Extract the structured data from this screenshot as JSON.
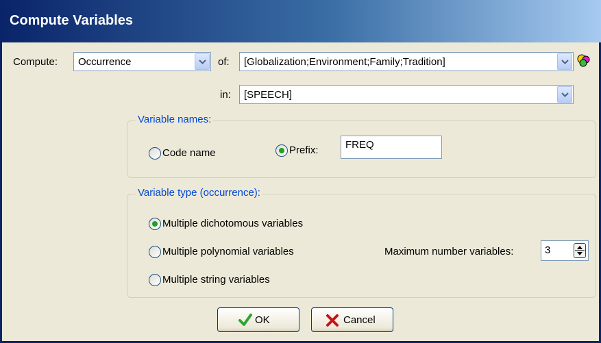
{
  "window": {
    "title": "Compute Variables"
  },
  "compute": {
    "label": "Compute:",
    "value": "Occurrence"
  },
  "of": {
    "label": "of:",
    "value": "[Globalization;Environment;Family;Tradition]",
    "icon": "variables-icon"
  },
  "in": {
    "label": "in:",
    "value": "[SPEECH]"
  },
  "variable_names": {
    "legend": "Variable names:",
    "code_name_label": "Code name",
    "prefix_label": "Prefix:",
    "prefix_value": "FREQ",
    "selected": "prefix"
  },
  "variable_type": {
    "legend": "Variable type (occurrence):",
    "options": [
      "Multiple dichotomous variables",
      "Multiple polynomial variables",
      "Multiple string variables"
    ],
    "selected_index": 0,
    "max_label": "Maximum number variables:",
    "max_value": "3"
  },
  "buttons": {
    "ok_label": "OK",
    "cancel_label": "Cancel"
  },
  "colors": {
    "titlebar": "#0a246a",
    "dialog_bg": "#ece9d8",
    "legend_text": "#0046d5",
    "ok_check": "#2ea52e",
    "cancel_x": "#c81414"
  }
}
